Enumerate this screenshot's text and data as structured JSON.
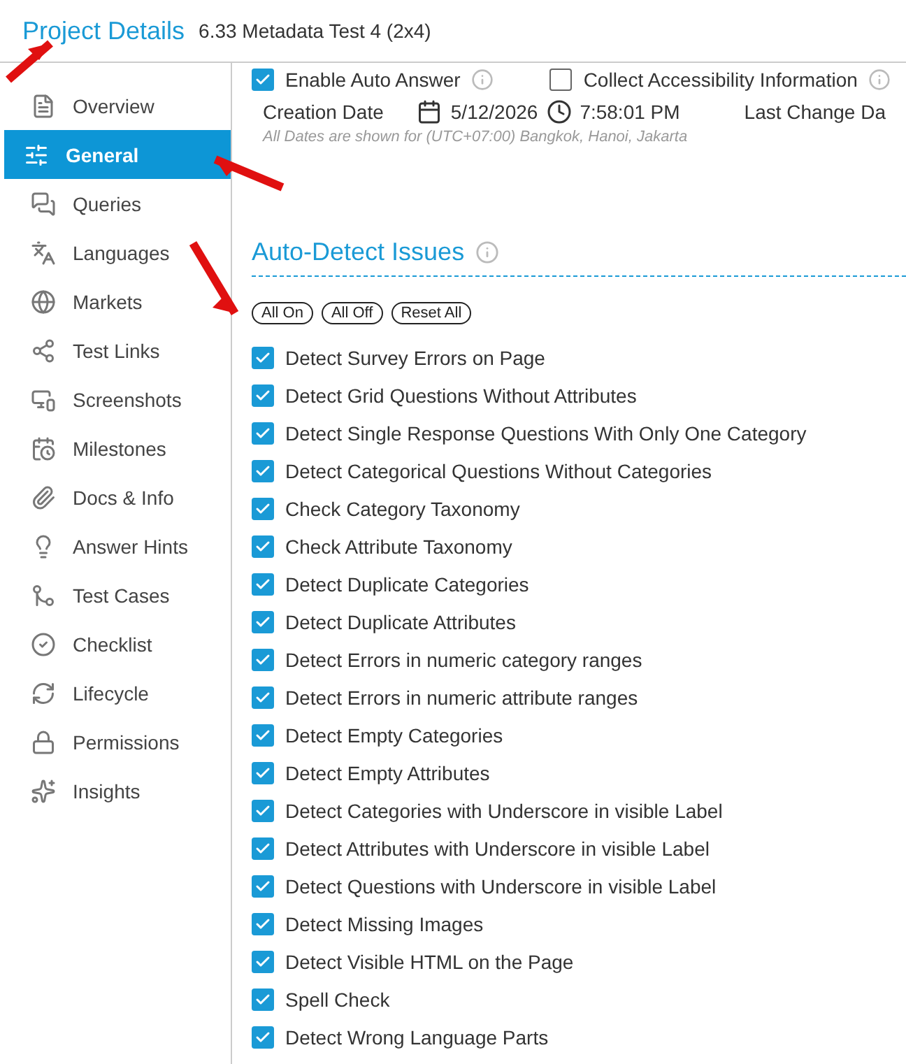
{
  "header": {
    "title": "Project Details",
    "subtitle": "6.33 Metadata Test 4 (2x4)"
  },
  "sidebar": {
    "items": [
      {
        "label": "Overview",
        "selected": false
      },
      {
        "label": "General",
        "selected": true
      },
      {
        "label": "Queries",
        "selected": false
      },
      {
        "label": "Languages",
        "selected": false
      },
      {
        "label": "Markets",
        "selected": false
      },
      {
        "label": "Test Links",
        "selected": false
      },
      {
        "label": "Screenshots",
        "selected": false
      },
      {
        "label": "Milestones",
        "selected": false
      },
      {
        "label": "Docs & Info",
        "selected": false
      },
      {
        "label": "Answer Hints",
        "selected": false
      },
      {
        "label": "Test Cases",
        "selected": false
      },
      {
        "label": "Checklist",
        "selected": false
      },
      {
        "label": "Lifecycle",
        "selected": false
      },
      {
        "label": "Permissions",
        "selected": false
      },
      {
        "label": "Insights",
        "selected": false
      }
    ]
  },
  "options": [
    {
      "label": "Enable Auto Answer",
      "checked": true
    },
    {
      "label": "Collect Accessibility Information",
      "checked": false
    }
  ],
  "dates": {
    "creation_label": "Creation Date",
    "date": "5/12/2026",
    "time": "7:58:01 PM",
    "last_change_label": "Last Change Da",
    "note": "All Dates are shown for (UTC+07:00) Bangkok, Hanoi, Jakarta"
  },
  "section": {
    "title": "Auto-Detect Issues"
  },
  "buttons": [
    "All On",
    "All Off",
    "Reset All"
  ],
  "checks": [
    {
      "label": "Detect Survey Errors on Page",
      "checked": true
    },
    {
      "label": "Detect Grid Questions Without Attributes",
      "checked": true
    },
    {
      "label": "Detect Single Response Questions With Only One Category",
      "checked": true
    },
    {
      "label": "Detect Categorical Questions Without Categories",
      "checked": true
    },
    {
      "label": "Check Category Taxonomy",
      "checked": true
    },
    {
      "label": "Check Attribute Taxonomy",
      "checked": true
    },
    {
      "label": "Detect Duplicate Categories",
      "checked": true
    },
    {
      "label": "Detect Duplicate Attributes",
      "checked": true
    },
    {
      "label": "Detect Errors in numeric category ranges",
      "checked": true
    },
    {
      "label": "Detect Errors in numeric attribute ranges",
      "checked": true
    },
    {
      "label": "Detect Empty Categories",
      "checked": true
    },
    {
      "label": "Detect Empty Attributes",
      "checked": true
    },
    {
      "label": "Detect Categories with Underscore in visible Label",
      "checked": true
    },
    {
      "label": "Detect Attributes with Underscore in visible Label",
      "checked": true
    },
    {
      "label": "Detect Questions with Underscore in visible Label",
      "checked": true
    },
    {
      "label": "Detect Missing Images",
      "checked": true
    },
    {
      "label": "Detect Visible HTML on the Page",
      "checked": true
    },
    {
      "label": "Spell Check",
      "checked": true
    },
    {
      "label": "Detect Wrong Language Parts",
      "checked": true
    }
  ]
}
